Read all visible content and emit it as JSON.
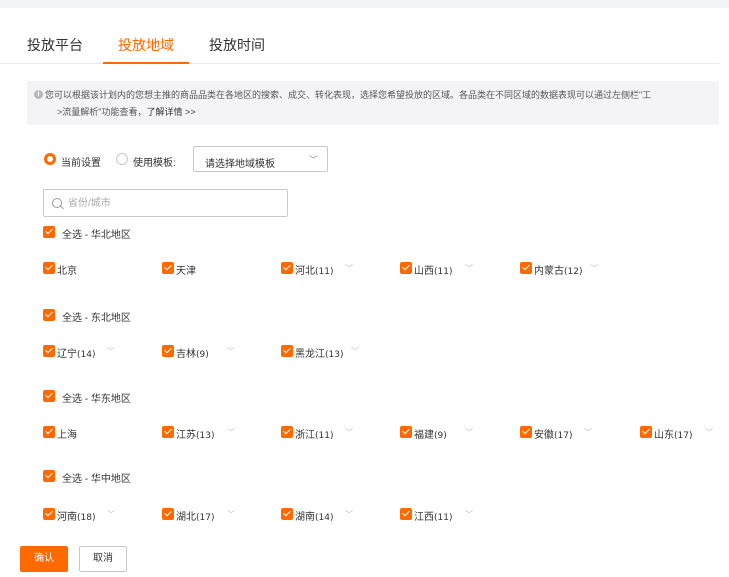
{
  "tabs": [
    {
      "label": "投放平台"
    },
    {
      "label": "投放地域"
    },
    {
      "label": "投放时间"
    }
  ],
  "notice": {
    "line1": "您可以根据该计划内的您想主推的商品品类在各地区的搜索、成交、转化表现，选择您希望投放的区域。各品类在不同区域的数据表现可以通过左侧栏\"工",
    "line2": ">流量解析\"功能查看，",
    "more": "了解详情 >>"
  },
  "mode": {
    "current_label": "当前设置",
    "template_label": "使用模板:",
    "select_value": "请选择地域模板"
  },
  "search": {
    "placeholder": "省份/城市"
  },
  "groups": [
    {
      "title": "全选 - 华北地区",
      "provinces": [
        {
          "name": "北京",
          "count": "",
          "chevron": false
        },
        {
          "name": "天津",
          "count": "",
          "chevron": false
        },
        {
          "name": "河北",
          "count": "(11)",
          "chevron": true
        },
        {
          "name": "山西",
          "count": "(11)",
          "chevron": true
        },
        {
          "name": "内蒙古",
          "count": "(12)",
          "chevron": true
        }
      ]
    },
    {
      "title": "全选 - 东北地区",
      "provinces": [
        {
          "name": "辽宁",
          "count": "(14)",
          "chevron": true
        },
        {
          "name": "吉林",
          "count": "(9)",
          "chevron": true
        },
        {
          "name": "黑龙江",
          "count": "(13)",
          "chevron": true
        }
      ]
    },
    {
      "title": "全选 - 华东地区",
      "provinces": [
        {
          "name": "上海",
          "count": "",
          "chevron": false
        },
        {
          "name": "江苏",
          "count": "(13)",
          "chevron": true
        },
        {
          "name": "浙江",
          "count": "(11)",
          "chevron": true
        },
        {
          "name": "福建",
          "count": "(9)",
          "chevron": true
        },
        {
          "name": "安徽",
          "count": "(17)",
          "chevron": true
        },
        {
          "name": "山东",
          "count": "(17)",
          "chevron": true
        }
      ]
    },
    {
      "title": "全选 - 华中地区",
      "provinces": [
        {
          "name": "河南",
          "count": "(18)",
          "chevron": true
        },
        {
          "name": "湖北",
          "count": "(17)",
          "chevron": true
        },
        {
          "name": "湖南",
          "count": "(14)",
          "chevron": true
        },
        {
          "name": "江西",
          "count": "(11)",
          "chevron": true
        }
      ]
    }
  ],
  "footer": {
    "confirm": "确认",
    "cancel": "取消"
  },
  "colors": {
    "accent": "#ff6a00"
  },
  "icons": {
    "info": "info-icon",
    "search": "search-icon",
    "select": "chevron-down-icon",
    "province": "chevron-down-icon"
  }
}
